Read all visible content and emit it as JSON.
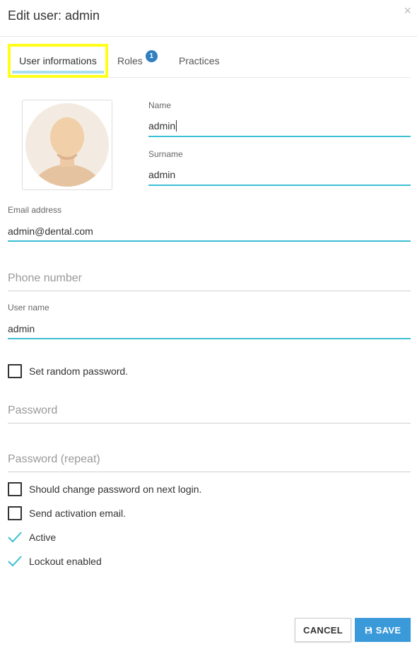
{
  "modal": {
    "title": "Edit user: admin",
    "close_glyph": "×"
  },
  "tabs": [
    {
      "label": "User informations",
      "active": true,
      "highlighted": true
    },
    {
      "label": "Roles",
      "badge": "1"
    },
    {
      "label": "Practices"
    }
  ],
  "avatar": {
    "icon": "user-avatar-icon"
  },
  "form": {
    "name": {
      "label": "Name",
      "value": "admin"
    },
    "surname": {
      "label": "Surname",
      "value": "admin"
    },
    "email": {
      "label": "Email address",
      "value": "admin@dental.com"
    },
    "phone": {
      "placeholder": "Phone number",
      "value": ""
    },
    "username": {
      "label": "User name",
      "value": "admin"
    },
    "set_random_password": {
      "label": "Set random password.",
      "checked": false
    },
    "password": {
      "placeholder": "Password",
      "value": ""
    },
    "password_repeat": {
      "placeholder": "Password (repeat)",
      "value": ""
    },
    "should_change_password": {
      "label": "Should change password on next login.",
      "checked": false
    },
    "send_activation_email": {
      "label": "Send activation email.",
      "checked": false
    },
    "active": {
      "label": "Active",
      "checked": true
    },
    "lockout_enabled": {
      "label": "Lockout enabled",
      "checked": true
    }
  },
  "footer": {
    "cancel_label": "CANCEL",
    "save_label": "SAVE"
  },
  "colors": {
    "accent_line": "#3dbfd4",
    "save_button": "#3a9ad9",
    "badge": "#2f7fc1",
    "tab_highlight_border": "#ffff1a",
    "tab_underline": "#a9dff1"
  }
}
